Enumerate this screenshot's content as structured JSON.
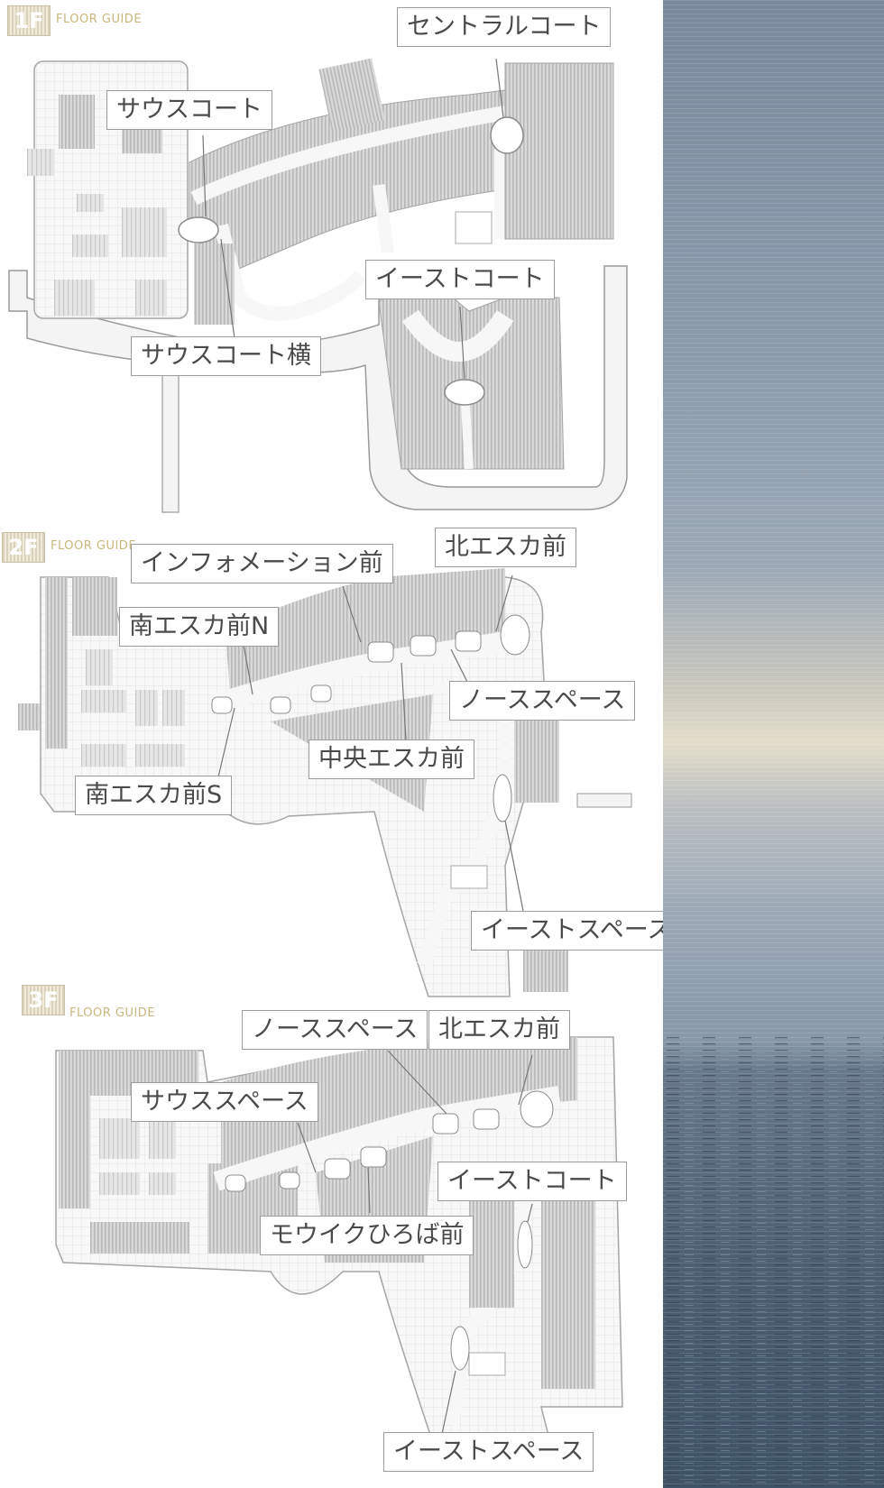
{
  "floor_guides": [
    {
      "floor": "1F",
      "guide_label": "FLOOR GUIDE",
      "labels": [
        "セントラルコート",
        "サウスコート",
        "イーストコート",
        "サウスコート横"
      ]
    },
    {
      "floor": "2F",
      "guide_label": "FLOOR GUIDE",
      "labels": [
        "インフォメーション前",
        "北エスカ前",
        "南エスカ前N",
        "ノーススペース",
        "中央エスカ前",
        "南エスカ前S",
        "イーストスペースN"
      ]
    },
    {
      "floor": "3F",
      "guide_label": "FLOOR GUIDE",
      "labels": [
        "ノーススペース",
        "北エスカ前",
        "サウススペース",
        "イーストコート",
        "モウイクひろば前",
        "イーストスペース"
      ]
    }
  ],
  "colors": {
    "label_text": "#4a4a4a",
    "callout_border": "#9c9c9c",
    "floor_badge": "#d9d2b8",
    "floor_guide_text": "#c9b77c",
    "map_block": "#d8d8d8",
    "map_block_stripe": "#bdbdbd",
    "corridor": "#f7f7f7",
    "sky": "#8796a8",
    "sea": "#4a5d70"
  }
}
